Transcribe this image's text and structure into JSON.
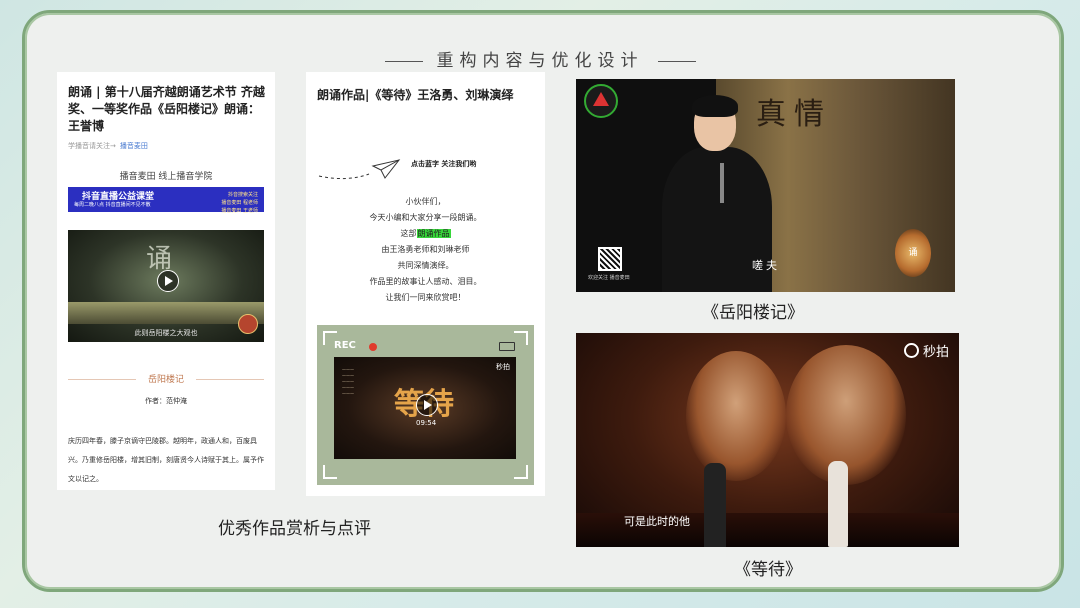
{
  "header": {
    "title": "重构内容与优化设计"
  },
  "card1": {
    "title": "朗诵 | 第十八届齐越朗诵艺术节 齐越奖、一等奖作品《岳阳楼记》朗诵：王誉博",
    "meta": "学播音请关注→",
    "meta_link": "播音麦田",
    "brand": "播音麦田    线上播音学院",
    "banner_main": "抖音直播公益课堂",
    "banner_sub": "每周二晚八点 抖音直播间不见不散",
    "banner_right1": "抖音搜索关注",
    "banner_right2": "播音麦田 程老师",
    "banner_right3": "播音麦田 王老师",
    "video_char": "诵",
    "video_subtitle": "此则岳阳楼之大观也",
    "section_label": "岳阳楼记",
    "author": "作者：范仲淹",
    "body": "庆历四年春，滕子京谪守巴陵郡。越明年，政通人和，百废具兴。乃重修岳阳楼，增其旧制，刻唐贤今人诗赋于其上。属予作文以记之。"
  },
  "card2": {
    "title": "朗诵作品|《等待》王洛勇、刘琳演绎",
    "follow": "点击蓝字 关注我们哟",
    "intro_lines": [
      "小伙伴们，",
      "今天小编和大家分享一段朗诵。",
      "这部",
      "朗诵作品",
      "由王洛勇老师和刘琳老师",
      "共同深情演绎。",
      "作品里的故事让人感动、泪目。",
      "让我们一同来欣赏吧！"
    ],
    "rec": "REC",
    "video_title": "等待",
    "video_time": "09:54",
    "video_brand": "秒拍"
  },
  "captions": {
    "analysis": "优秀作品赏析与点评",
    "yueyang": "《岳阳楼记》",
    "dengdai": "《等待》"
  },
  "shot1": {
    "painting_text": "真情",
    "subtitle": "嗟夫",
    "qr_text": "欢迎关注 播音麦田",
    "badge": "诵"
  },
  "shot2": {
    "brand": "秒拍",
    "subtitle": "可是此时的他"
  },
  "colors": {
    "frame": "#7fa77b",
    "banner": "#2b2fc0",
    "highlight": "#37d63a",
    "section": "#c07a52"
  }
}
